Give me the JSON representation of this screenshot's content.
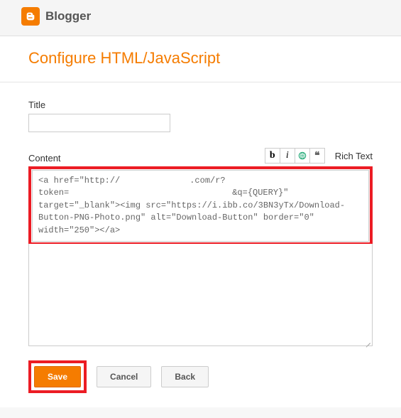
{
  "header": {
    "logo_text": "Blogger"
  },
  "page": {
    "title": "Configure HTML/JavaScript"
  },
  "form": {
    "title_label": "Title",
    "title_value": "",
    "content_label": "Content",
    "content_line1a": "<a href=\"http://",
    "content_line1b": ".com/r?",
    "content_line2a": "token=",
    "content_line2b": "&q={QUERY}\" ",
    "content_line3": "target=\"_blank\"><img src=\"https://i.ibb.co/3BN3yTx/Download-",
    "content_line4": "Button-PNG-Photo.png\" alt=\"Download-Button\" border=\"0\" ",
    "content_line5": "width=\"250\"></a>"
  },
  "toolbar": {
    "bold": "b",
    "italic": "i",
    "quote": "❝",
    "richtext": "Rich Text"
  },
  "buttons": {
    "save": "Save",
    "cancel": "Cancel",
    "back": "Back"
  }
}
